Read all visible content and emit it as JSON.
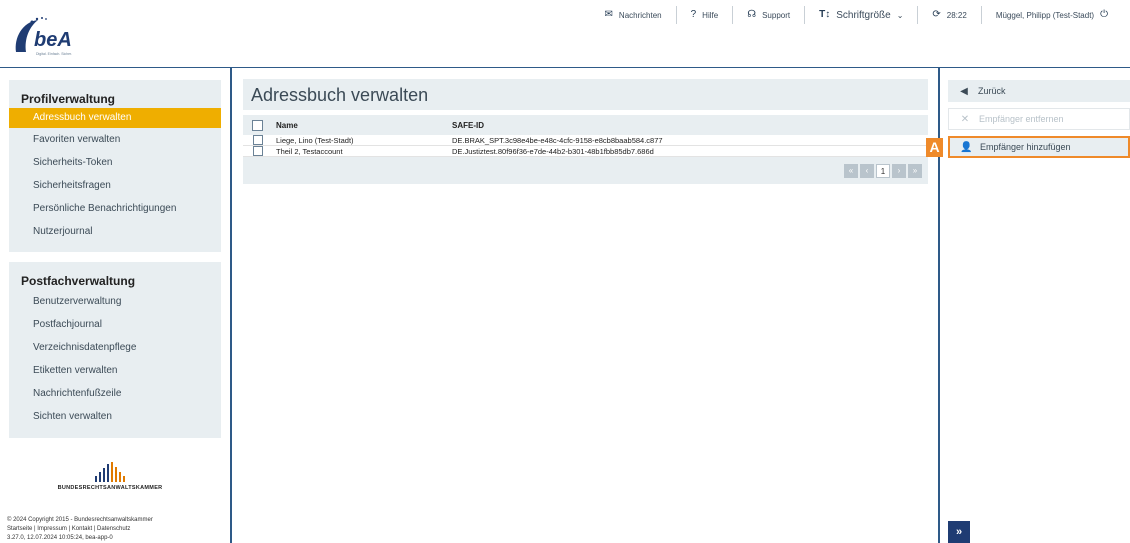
{
  "topnav": {
    "messages": "Nachrichten",
    "help": "Hilfe",
    "support": "Support",
    "font_size": "Schriftgröße",
    "timer": "28:22",
    "user": "Müggel, Philipp (Test-Stadt)"
  },
  "logo": {
    "text": "beA",
    "tagline": "Digital. Einfach. Sicher."
  },
  "sidebar": {
    "profile_title": "Profilverwaltung",
    "profile_items": [
      "Adressbuch verwalten",
      "Favoriten verwalten",
      "Sicherheits-Token",
      "Sicherheitsfragen",
      "Persönliche Benachrichtigungen",
      "Nutzerjournal"
    ],
    "postbox_title": "Postfachverwaltung",
    "postbox_items": [
      "Benutzerverwaltung",
      "Postfachjournal",
      "Verzeichnisdatenpflege",
      "Etiketten verwalten",
      "Nachrichtenfußzeile",
      "Sichten verwalten"
    ],
    "brak_name": "BUNDESRECHTSANWALTSKAMMER",
    "footer_lines": [
      "© 2024 Copyright 2015 - Bundesrechtsanwaltskammer",
      "Startseite | Impressum | Kontakt | Datenschutz",
      "3.27.0, 12.07.2024 10:05:24, bea-app-0"
    ]
  },
  "main": {
    "title": "Adressbuch verwalten",
    "columns": {
      "name": "Name",
      "safe_id": "SAFE-ID"
    },
    "rows": [
      {
        "name": "Liege, Lino (Test-Stadt)",
        "safe_id": "DE.BRAK_SPT.3c98e4be-e48c-4cfc-9158-e8cb8baab584.c877"
      },
      {
        "name": "Theil 2, Testaccount",
        "safe_id": "DE.Justiztest.80f96f36-e7de-44b2-b301-48b1fbb85db7.686d"
      }
    ],
    "pager": {
      "first": "«",
      "prev": "‹",
      "current": "1",
      "next": "›",
      "last": "»"
    }
  },
  "actions": {
    "back": "Zurück",
    "remove": "Empfänger entfernen",
    "add": "Empfänger hinzufügen",
    "badge": "A",
    "expand": "»"
  },
  "colors": {
    "accent": "#efae00",
    "primary": "#2e5a88",
    "highlight": "#ef8a2a"
  }
}
